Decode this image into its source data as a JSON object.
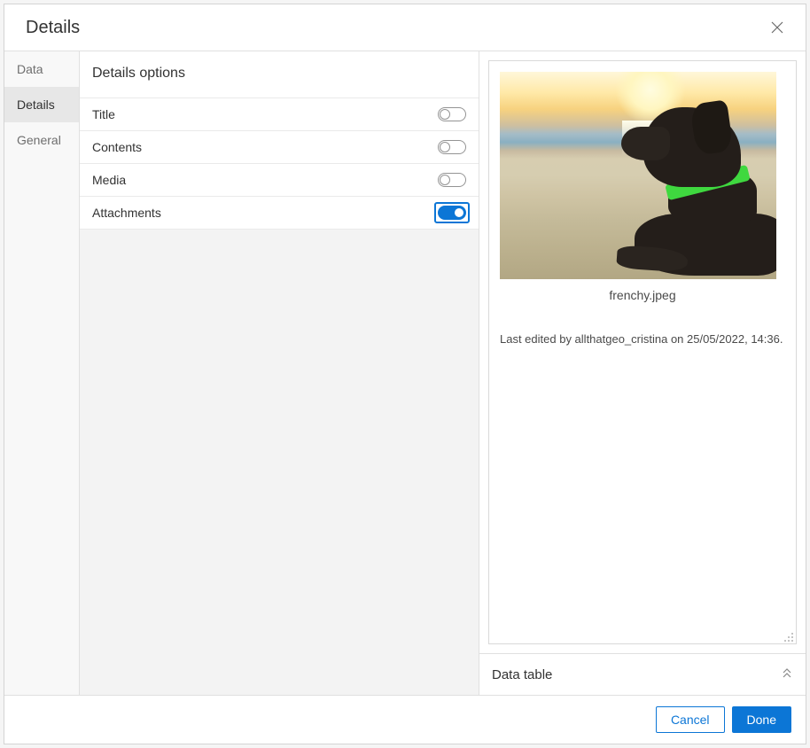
{
  "modal": {
    "title": "Details"
  },
  "sidebar": {
    "items": [
      {
        "label": "Data",
        "active": false
      },
      {
        "label": "Details",
        "active": true
      },
      {
        "label": "General",
        "active": false
      }
    ]
  },
  "options": {
    "header": "Details options",
    "rows": [
      {
        "label": "Title",
        "on": false
      },
      {
        "label": "Contents",
        "on": false
      },
      {
        "label": "Media",
        "on": false
      },
      {
        "label": "Attachments",
        "on": true
      }
    ]
  },
  "preview": {
    "attachment_name": "frenchy.jpeg",
    "last_edited": "Last edited by allthatgeo_cristina on 25/05/2022, 14:36."
  },
  "data_table": {
    "label": "Data table"
  },
  "footer": {
    "cancel": "Cancel",
    "done": "Done"
  }
}
